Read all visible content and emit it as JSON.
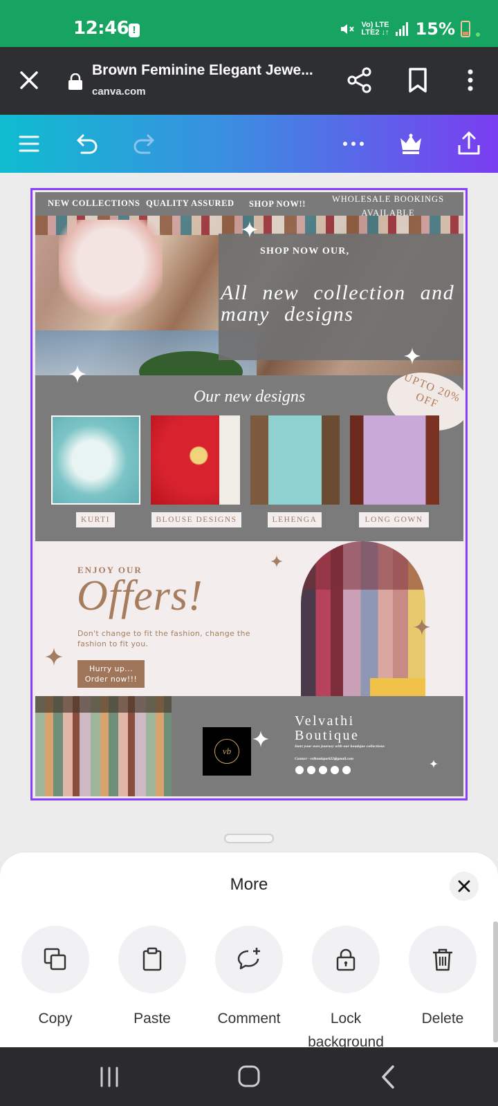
{
  "status_bar": {
    "time": "12:46",
    "alert_glyph": "!",
    "network_top": "Vo) LTE",
    "network_bottom": "LTE2 ↓↑",
    "battery": "15%"
  },
  "browser": {
    "page_title": "Brown Feminine Elegant Jewe...",
    "url": "canva.com"
  },
  "design": {
    "banner_links": [
      "NEW COLLECTIONS",
      "QUALITY ASSURED",
      "SHOP NOW!!"
    ],
    "wholesale": "WHOLESALE BOOKINGS AVAILABLE",
    "shop_now_our": "SHOP NOW OUR,",
    "headline": "All new collection and many designs",
    "designs_title": "Our new designs",
    "offer_badge": "UPTO 20% OFF",
    "products": [
      {
        "label": "KURTI"
      },
      {
        "label": "BLOUSE DESIGNS"
      },
      {
        "label": "LEHENGA"
      },
      {
        "label": "LONG GOWN"
      }
    ],
    "enjoy_our": "ENJOY OUR",
    "offers_title": "Offers!",
    "tagline": "Don't change to fit the fashion, change the fashion to fit you.",
    "hurry_button": "Hurry up... Order now!!!",
    "logo_mark": "vb",
    "brand_name": "Velvathi Boutique",
    "brand_subtitle": "Start your own journey with our boutique collections",
    "brand_contact": "Contact - velboutique022@gmail.com"
  },
  "sheet": {
    "title": "More",
    "actions": [
      {
        "label": "Copy",
        "icon": "copy-icon"
      },
      {
        "label": "Paste",
        "icon": "paste-icon"
      },
      {
        "label": "Comment",
        "icon": "comment-add-icon"
      },
      {
        "label": "Lock background",
        "icon": "lock-icon"
      },
      {
        "label": "Delete",
        "icon": "trash-icon"
      }
    ]
  },
  "colors": {
    "status_bar": "#17a463",
    "browser_bar": "#2d2f33",
    "toolbar_gradient_start": "#0fbcd0",
    "toolbar_gradient_end": "#7a3df0",
    "selection": "#8b3dff",
    "design_grey": "#7b7b7b",
    "design_cream": "#f3eeed",
    "design_brown": "#a67c5e"
  }
}
